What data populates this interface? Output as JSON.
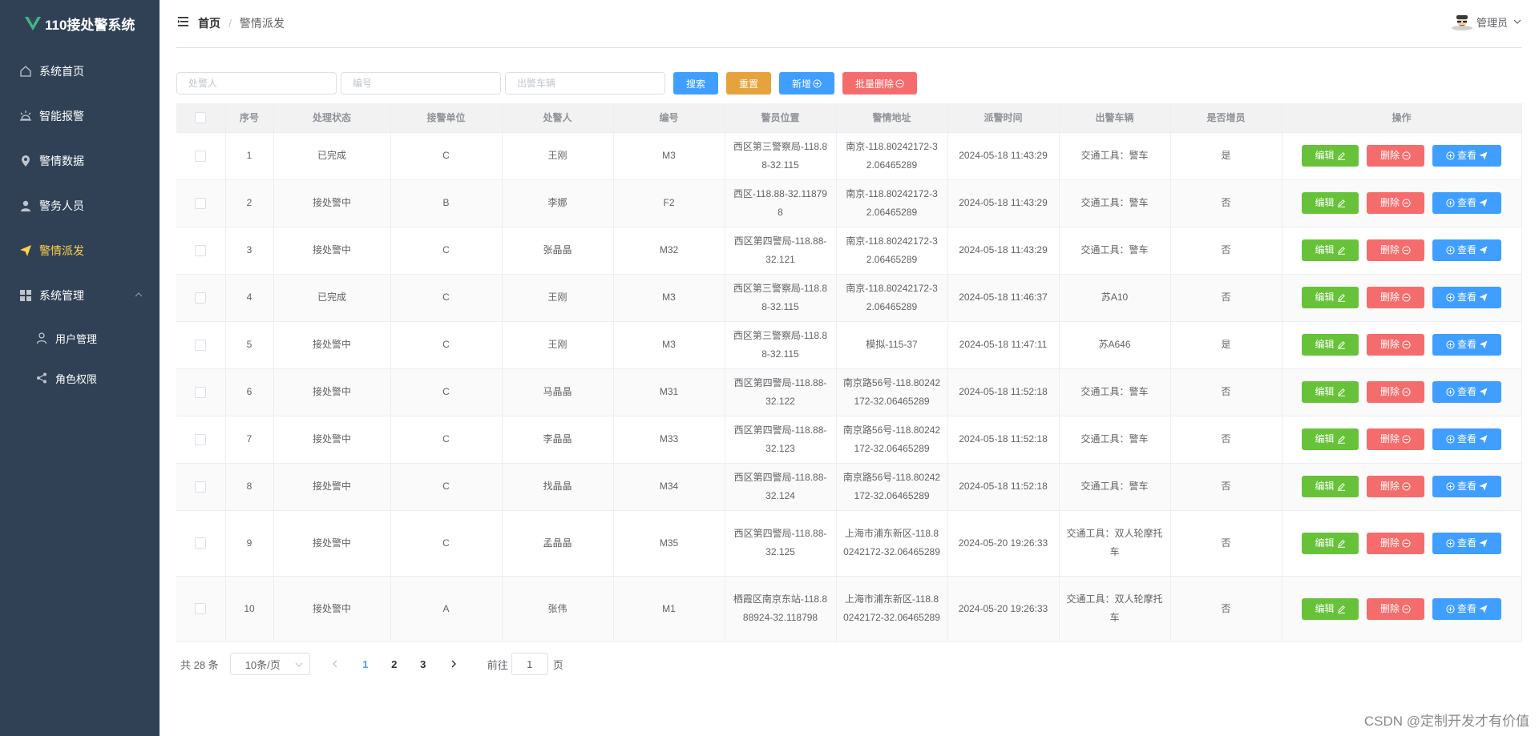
{
  "sidebar": {
    "app_title": "110接处警系统",
    "items": [
      {
        "label": "系统首页",
        "icon": "home-icon"
      },
      {
        "label": "智能报警",
        "icon": "alarm-icon"
      },
      {
        "label": "警情数据",
        "icon": "location-icon"
      },
      {
        "label": "警务人员",
        "icon": "user-icon"
      },
      {
        "label": "警情派发",
        "icon": "send-icon",
        "active": true
      },
      {
        "label": "系统管理",
        "icon": "grid-icon",
        "expanded": true
      }
    ],
    "subitems": [
      {
        "label": "用户管理",
        "icon": "user-outline-icon"
      },
      {
        "label": "角色权限",
        "icon": "share-icon"
      }
    ],
    "colors": {
      "bg": "#304156",
      "active": "#ffd04b"
    }
  },
  "header": {
    "breadcrumb_home": "首页",
    "breadcrumb_sep": "/",
    "breadcrumb_current": "警情派发",
    "user_name": "管理员"
  },
  "search": {
    "handler_placeholder": "处警人",
    "number_placeholder": "编号",
    "vehicle_placeholder": "出警车辆",
    "search_label": "搜索",
    "reset_label": "重置",
    "add_label": "新增",
    "batch_delete_label": "批量删除"
  },
  "table": {
    "columns": [
      "序号",
      "处理状态",
      "接警单位",
      "处警人",
      "编号",
      "警员位置",
      "警情地址",
      "派警时间",
      "出警车辆",
      "是否增员",
      "操作"
    ],
    "actions": {
      "edit": "编辑",
      "delete": "删除",
      "view": "查看"
    },
    "rows": [
      {
        "no": "1",
        "status": "已完成",
        "unit": "C",
        "handler": "王刚",
        "code": "M3",
        "position": "西区第三警察局-118.88-32.115",
        "address": "南京-118.80242172-32.06465289",
        "time": "2024-05-18 11:43:29",
        "vehicle": "交通工具：警车",
        "reinforce": "是"
      },
      {
        "no": "2",
        "status": "接处警中",
        "unit": "B",
        "handler": "李娜",
        "code": "F2",
        "position": "西区-118.88-32.118798",
        "address": "南京-118.80242172-32.06465289",
        "time": "2024-05-18 11:43:29",
        "vehicle": "交通工具：警车",
        "reinforce": "否"
      },
      {
        "no": "3",
        "status": "接处警中",
        "unit": "C",
        "handler": "张晶晶",
        "code": "M32",
        "position": "西区第四警局-118.88-32.121",
        "address": "南京-118.80242172-32.06465289",
        "time": "2024-05-18 11:43:29",
        "vehicle": "交通工具：警车",
        "reinforce": "否"
      },
      {
        "no": "4",
        "status": "已完成",
        "unit": "C",
        "handler": "王刚",
        "code": "M3",
        "position": "西区第三警察局-118.88-32.115",
        "address": "南京-118.80242172-32.06465289",
        "time": "2024-05-18 11:46:37",
        "vehicle": "苏A10",
        "reinforce": "否"
      },
      {
        "no": "5",
        "status": "接处警中",
        "unit": "C",
        "handler": "王刚",
        "code": "M3",
        "position": "西区第三警察局-118.88-32.115",
        "address": "模拟-115-37",
        "time": "2024-05-18 11:47:11",
        "vehicle": "苏A646",
        "reinforce": "是"
      },
      {
        "no": "6",
        "status": "接处警中",
        "unit": "C",
        "handler": "马晶晶",
        "code": "M31",
        "position": "西区第四警局-118.88-32.122",
        "address": "南京路56号-118.80242172-32.06465289",
        "time": "2024-05-18 11:52:18",
        "vehicle": "交通工具：警车",
        "reinforce": "否"
      },
      {
        "no": "7",
        "status": "接处警中",
        "unit": "C",
        "handler": "李晶晶",
        "code": "M33",
        "position": "西区第四警局-118.88-32.123",
        "address": "南京路56号-118.80242172-32.06465289",
        "time": "2024-05-18 11:52:18",
        "vehicle": "交通工具：警车",
        "reinforce": "否"
      },
      {
        "no": "8",
        "status": "接处警中",
        "unit": "C",
        "handler": "找晶晶",
        "code": "M34",
        "position": "西区第四警局-118.88-32.124",
        "address": "南京路56号-118.80242172-32.06465289",
        "time": "2024-05-18 11:52:18",
        "vehicle": "交通工具：警车",
        "reinforce": "否"
      },
      {
        "no": "9",
        "status": "接处警中",
        "unit": "C",
        "handler": "孟晶晶",
        "code": "M35",
        "position": "西区第四警局-118.88-32.125",
        "address": "上海市浦东新区-118.80242172-32.06465289",
        "time": "2024-05-20 19:26:33",
        "vehicle": "交通工具：双人轮摩托车",
        "reinforce": "否"
      },
      {
        "no": "10",
        "status": "接处警中",
        "unit": "A",
        "handler": "张伟",
        "code": "M1",
        "position": "栖霞区南京东站-118.888924-32.118798",
        "address": "上海市浦东新区-118.80242172-32.06465289",
        "time": "2024-05-20 19:26:33",
        "vehicle": "交通工具：双人轮摩托车",
        "reinforce": "否"
      }
    ]
  },
  "pagination": {
    "total": "共 28 条",
    "page_size": "10条/页",
    "pages": [
      "1",
      "2",
      "3"
    ],
    "current": "1",
    "goto_label": "前往",
    "goto_value": "1",
    "page_unit": "页"
  },
  "watermark": "CSDN @定制开发才有价值"
}
